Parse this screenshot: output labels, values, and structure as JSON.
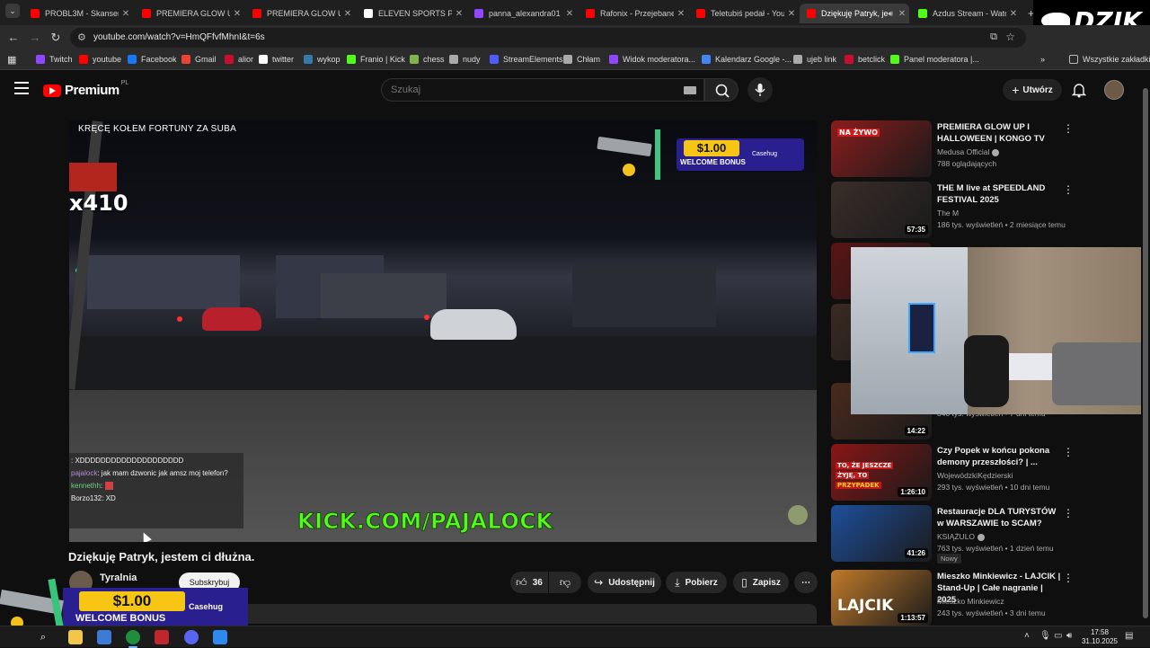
{
  "browser": {
    "tabs": [
      {
        "label": "PROBL3M - Skansen",
        "favicon_color": "#ff0000"
      },
      {
        "label": "PREMIERA GLOW UP",
        "favicon_color": "#ff0000"
      },
      {
        "label": "PREMIERA GLOW UP",
        "favicon_color": "#ff0000"
      },
      {
        "label": "ELEVEN SPORTS PL w",
        "favicon_color": "#ffffff"
      },
      {
        "label": "panna_alexandra01 -",
        "favicon_color": "#9146ff"
      },
      {
        "label": "Rafonix - Przejebane",
        "favicon_color": "#ff0000"
      },
      {
        "label": "Teletubiś pedał - You",
        "favicon_color": "#ff0000"
      },
      {
        "label": "Dziękuję Patryk, je",
        "favicon_color": "#ff0000"
      },
      {
        "label": "Azdus Stream - Wato",
        "favicon_color": "#53fc18"
      }
    ],
    "url": "youtube.com/watch?v=HmQFfvfMhnI&t=6s",
    "bookmarks": [
      {
        "label": "Twitch",
        "color": "#9146ff"
      },
      {
        "label": "youtube",
        "color": "#ff0000"
      },
      {
        "label": "Facebook",
        "color": "#1877f2"
      },
      {
        "label": "Gmail",
        "color": "#ea4335"
      },
      {
        "label": "alior",
        "color": "#c8102e"
      },
      {
        "label": "twitter",
        "color": "#ffffff"
      },
      {
        "label": "wykop",
        "color": "#367aa9"
      },
      {
        "label": "Franio | Kick",
        "color": "#53fc18"
      },
      {
        "label": "chess",
        "color": "#81b64c"
      },
      {
        "label": "nudy",
        "color": "#aaaaaa"
      },
      {
        "label": "StreamElements",
        "color": "#4d5bff"
      },
      {
        "label": "Chłam",
        "color": "#aaaaaa"
      },
      {
        "label": "Widok moderatora...",
        "color": "#9146ff"
      },
      {
        "label": "Kalendarz Google -...",
        "color": "#4285f4"
      },
      {
        "label": "ujeb link",
        "color": "#aaaaaa"
      },
      {
        "label": "betclick",
        "color": "#c8102e"
      },
      {
        "label": "Panel moderatora |...",
        "color": "#53fc18"
      }
    ],
    "all_bookmarks_label": "Wszystkie zakładki"
  },
  "overlay_logo": "DZIK",
  "youtube": {
    "logo_text": "Premium",
    "logo_region": "PL",
    "search_placeholder": "Szukaj",
    "create_label": "Utwórz"
  },
  "player": {
    "stream_title": "KRĘCĘ KOŁEM FORTUNY ZA SUBA",
    "multiplier": "x410",
    "promo_amount": "$1.00",
    "promo_text": "WELCOME BONUS",
    "promo_brand": "Casehug",
    "chat": [
      {
        "user": "",
        "text": ": XDDDDDDDDDDDDDDDDDDDD"
      },
      {
        "user": "pajalock",
        "text": ": jak mam dzwonic jak amsz moj telefon?"
      },
      {
        "user": "kennethh",
        "text": ":"
      },
      {
        "user": "Borzo132",
        "text": ": XD"
      }
    ],
    "watermark": "KICK.COM/PAJALOCK"
  },
  "video": {
    "title": "Dziękuję Patryk, jestem ci dłużna.",
    "channel": "Tyralnia",
    "subscribe_label": "Subskrybuj",
    "likes": "36",
    "share_label": "Udostępnij",
    "download_label": "Pobierz",
    "save_label": "Zapisz"
  },
  "recommendations": [
    {
      "title": "PREMIERA GLOW UP I HALLOWEEN | KONGO TV",
      "channel": "Medusa Official",
      "verified": true,
      "meta": "788 oglądających",
      "duration": "",
      "thumb_color": "#8b1c1c"
    },
    {
      "title": "THE M live at SPEEDLAND FESTIVAL 2025",
      "channel": "The M",
      "verified": false,
      "meta": "186 tys. wyświetleń • 2 miesiące temu",
      "duration": "57:35",
      "thumb_color": "#3a2e2a"
    },
    {
      "title": "",
      "channel": "",
      "verified": false,
      "meta": "",
      "duration": "",
      "thumb_color": "#5a1414"
    },
    {
      "title": "",
      "channel": "",
      "verified": false,
      "meta": "",
      "duration": "",
      "thumb_color": "#3a2a22"
    },
    {
      "title": "",
      "channel": "",
      "verified": false,
      "meta": "",
      "duration": "14:22",
      "thumb_color": "#4a2a1e"
    },
    {
      "title": "Czy Popek w końcu pokona demony przeszłości? | ...",
      "channel": "WojewódzkiKędzierski",
      "verified": false,
      "meta": "293 tys. wyświetleń • 10 dni temu",
      "duration": "1:26:10",
      "thumb_color": "#8a1616"
    },
    {
      "title": "Restauracje DLA TURYSTÓW w WARSZAWIE to SCAM?",
      "channel": "KSIĄŻULO",
      "verified": true,
      "meta": "763 tys. wyświetleń • 1 dzień temu",
      "duration": "41:26",
      "thumb_color": "#1e4f9c",
      "badge": "Nowy"
    },
    {
      "title": "Mieszko Minkiewicz - LAJCIK | Stand-Up | Całe nagranie | 2025",
      "channel": "Mieszko Minkiewicz",
      "verified": false,
      "meta": "243 tys. wyświetleń • 3 dni temu",
      "duration": "1:13:57",
      "thumb_color": "#c07a2a"
    }
  ],
  "rec_partial": {
    "rec4_meta": "340 tys. wyświetleń • 7 dni temu"
  },
  "thumb_texts": {
    "rec1": "NA ŻYWO",
    "rec6_line1": "TO, ŻE JESZCZE",
    "rec6_line2": "ŻYJĘ, TO",
    "rec6_line3": "PRZYPADEK",
    "rec8": "LAJCIK"
  },
  "taskbar": {
    "time": "17:58",
    "date": "31.10.2025"
  }
}
